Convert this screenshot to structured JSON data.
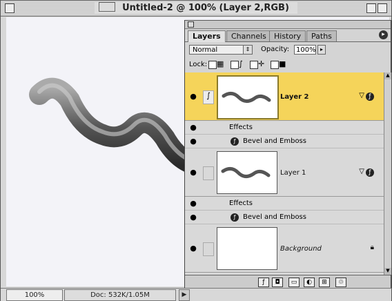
{
  "window": {
    "title": "Untitled-2 @ 100% (Layer 2,RGB)"
  },
  "status": {
    "zoom": "100%",
    "doc_size": "Doc: 532K/1.05M"
  },
  "palette": {
    "tabs": [
      "Layers",
      "Channels",
      "History",
      "Paths"
    ],
    "active_tab": "Layers",
    "blend_mode": "Normal",
    "opacity_label": "Opacity:",
    "opacity_value": "100%",
    "lock_label": "Lock:",
    "layers": [
      {
        "name": "Layer 2",
        "selected": true,
        "effects_label": "Effects",
        "effect": "Bevel and Emboss"
      },
      {
        "name": "Layer 1",
        "selected": false,
        "effects_label": "Effects",
        "effect": "Bevel and Emboss"
      },
      {
        "name": "Background",
        "selected": false
      }
    ]
  },
  "colors": {
    "selected_layer": "#f5d45a",
    "stroke_dark": "#3a3a3a",
    "stroke_light": "#a8a8a8"
  },
  "icons": [
    "close-box",
    "zoom-box",
    "collapse-box",
    "eye-icon",
    "brush-icon",
    "effects-icon",
    "lock-icon",
    "trash-icon",
    "new-layer-icon"
  ]
}
